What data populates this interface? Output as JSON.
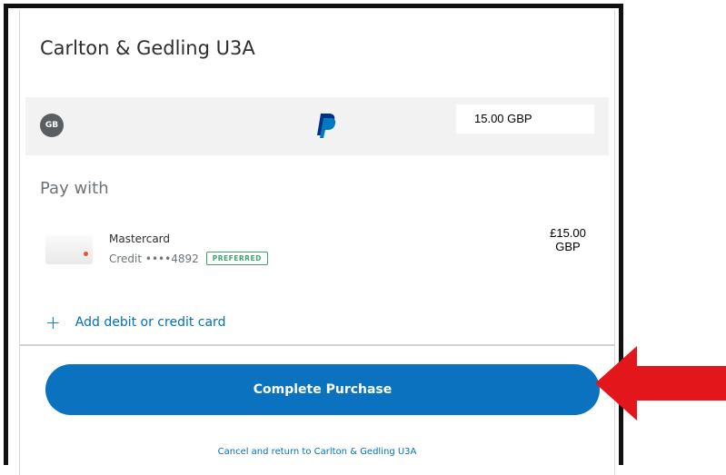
{
  "merchant": {
    "title": "Carlton & Gedling U3A"
  },
  "summary": {
    "country_badge": "GB",
    "logo_icon": "paypal-logo-icon",
    "amount": "15.00 GBP"
  },
  "payment": {
    "heading": "Pay with",
    "card": {
      "name": "Mastercard",
      "detail": "Credit ••••4892",
      "badge": "PREFERRED",
      "amount_line1": "£15.00",
      "amount_line2": "GBP"
    },
    "add_card": {
      "icon": "+",
      "label": "Add debit or credit card"
    }
  },
  "actions": {
    "complete_label": "Complete Purchase",
    "cancel_label": "Cancel and return to Carlton & Gedling U3A"
  },
  "colors": {
    "primary_button": "#0a72be",
    "link": "#0070ba",
    "preferred_badge": "#3ea36b",
    "annotation_arrow": "#e2161b"
  }
}
